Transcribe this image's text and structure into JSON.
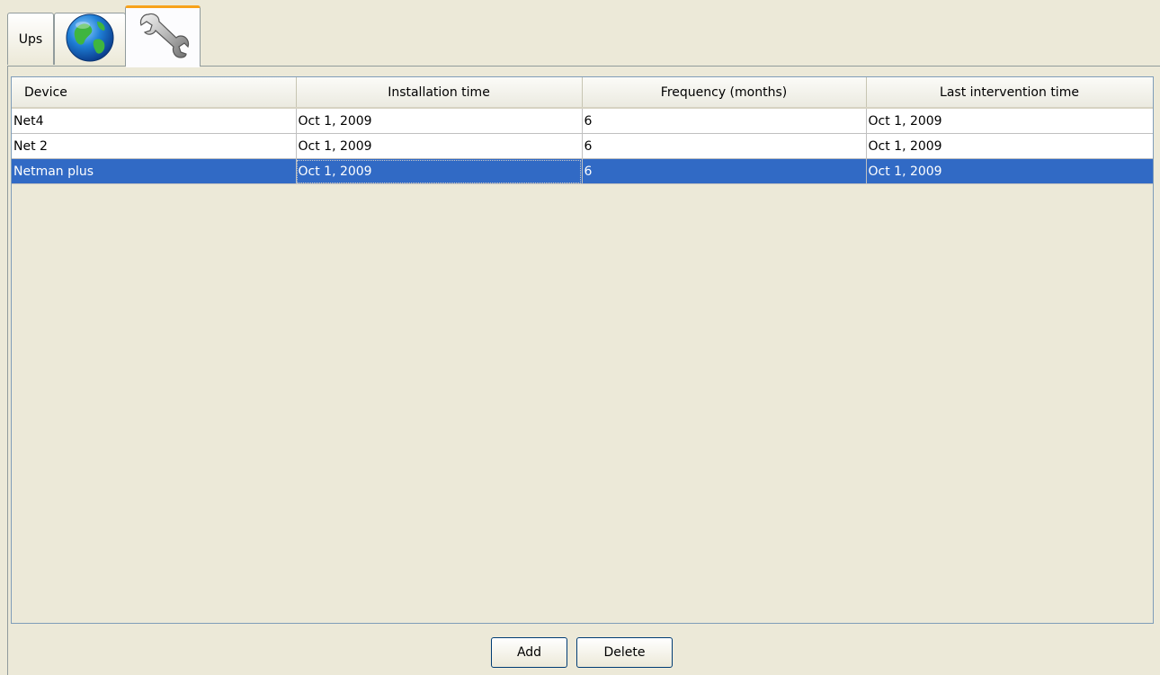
{
  "tabs": [
    {
      "label": "Ups"
    },
    {
      "icon": "globe-icon"
    },
    {
      "icon": "wrench-icon",
      "selected": true
    }
  ],
  "table": {
    "columns": [
      "Device",
      "Installation time",
      "Frequency (months)",
      "Last intervention time"
    ],
    "rows": [
      {
        "device": "Net4",
        "installation": "Oct 1, 2009",
        "frequency": "6",
        "last": "Oct 1, 2009"
      },
      {
        "device": "Net 2",
        "installation": "Oct 1, 2009",
        "frequency": "6",
        "last": "Oct 1, 2009"
      },
      {
        "device": "Netman plus",
        "installation": "Oct 1, 2009",
        "frequency": "6",
        "last": "Oct 1, 2009",
        "selected": true
      }
    ]
  },
  "buttons": {
    "add_label": "Add",
    "delete_label": "Delete"
  },
  "colors": {
    "background": "#ece9d8",
    "selection": "#316ac5",
    "active_tab_accent": "#f7a21a"
  }
}
